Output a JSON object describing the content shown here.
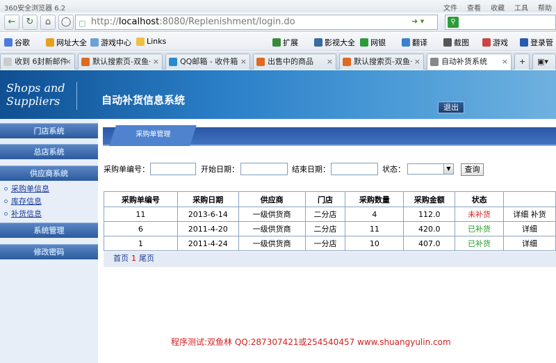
{
  "browser": {
    "title": "360安全浏览器 6.2",
    "menu": [
      "文件",
      "查看",
      "收藏",
      "工具",
      "帮助"
    ],
    "url_prefix": "http://",
    "url_host": "localhost",
    "url_rest": ":8080/Replenishment/login.do",
    "favorites": [
      {
        "label": "谷歌",
        "color": "#4a7be0"
      },
      {
        "label": "网址大全",
        "color": "#e8a020"
      },
      {
        "label": "游戏中心",
        "color": "#6aa2d8"
      },
      {
        "label": "Links",
        "color": "#f0c040"
      },
      {
        "label": "扩展",
        "color": "#3a8a3a"
      },
      {
        "label": "影视大全",
        "color": "#3a6aa0"
      },
      {
        "label": "网银",
        "color": "#2d9b3a"
      },
      {
        "label": "翻译",
        "color": "#3a80d0"
      },
      {
        "label": "截图",
        "color": "#555555"
      },
      {
        "label": "游戏",
        "color": "#cc4444"
      },
      {
        "label": "登录管",
        "color": "#2a5ab0"
      }
    ],
    "tabs": [
      {
        "label": "收到 6封新邮件",
        "color": "#cccccc"
      },
      {
        "label": "默认搜索页-双鱼·",
        "color": "#e06a20"
      },
      {
        "label": "QQ邮箱 - 收件箱",
        "color": "#2a8ad0"
      },
      {
        "label": "出售中的商品",
        "color": "#e06a20"
      },
      {
        "label": "默认搜索页-双鱼·",
        "color": "#e06a20"
      },
      {
        "label": "自动补货系统",
        "color": "#888888"
      }
    ]
  },
  "app": {
    "logo_line1": "Shops and",
    "logo_line2": "Suppliers",
    "system_name": "自动补货信息系统",
    "logout_label": "退出"
  },
  "sidebar": {
    "sections": [
      "门店系统",
      "总店系统",
      "供应商系统",
      "系统管理",
      "修改密码"
    ],
    "items": [
      "采购单信息",
      "库存信息",
      "补货信息"
    ]
  },
  "main": {
    "section_title": "采购单管理",
    "filter": {
      "order_no_label": "采购单编号：",
      "start_date_label": "开始日期：",
      "end_date_label": "结束日期：",
      "status_label": "状态：",
      "query_label": "查询"
    },
    "table": {
      "headers": [
        "采购单编号",
        "采购日期",
        "供应商",
        "门店",
        "采购数量",
        "采购金额",
        "状态",
        ""
      ],
      "rows": [
        {
          "no": "11",
          "date": "2013-6-14",
          "supplier": "一级供货商",
          "store": "二分店",
          "qty": "4",
          "amount": "112.0",
          "status": "未补货",
          "status_color": "red",
          "actions": "详细 补货"
        },
        {
          "no": "6",
          "date": "2011-4-20",
          "supplier": "一级供货商",
          "store": "二分店",
          "qty": "11",
          "amount": "420.0",
          "status": "已补货",
          "status_color": "green",
          "actions": "详细"
        },
        {
          "no": "1",
          "date": "2011-4-24",
          "supplier": "一级供货商",
          "store": "一分店",
          "qty": "10",
          "amount": "407.0",
          "status": "已补货",
          "status_color": "green",
          "actions": "详细"
        }
      ]
    },
    "pager": {
      "first": "首页",
      "current": "1",
      "last": "尾页"
    }
  },
  "footer": {
    "text": "程序测试:双鱼林 QQ:287307421或254540457 www.shuangyulin.com"
  }
}
